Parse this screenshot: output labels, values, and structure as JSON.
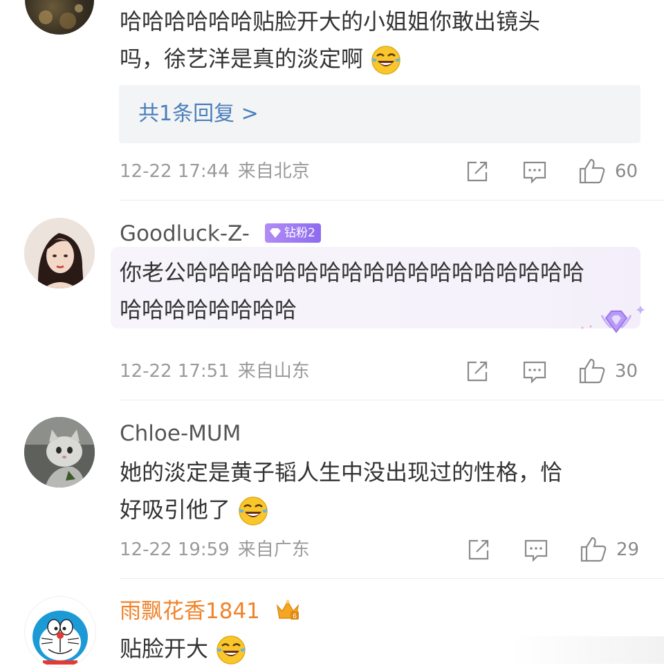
{
  "colors": {
    "link": "#4a7fb8",
    "meta": "#9a9a9a",
    "orange_name": "#f08329",
    "badge": "#9b7bf2"
  },
  "comments": [
    {
      "username": "",
      "text_line1": "哈哈哈哈哈哈贴脸开大的小姐姐你敢出镜头",
      "text_line2": "吗，徐艺洋是真的淡定啊",
      "emoji": "laugh-cry-emoji",
      "replies_link": "共1条回复 >",
      "time": "12-22 17:44",
      "location": "来自北京",
      "likes": "60"
    },
    {
      "username": "Goodluck-Z-",
      "badge": "钻粉2",
      "text_line1": "你老公哈哈哈哈哈哈哈哈哈哈哈哈哈哈哈哈哈哈",
      "text_line2": "哈哈哈哈哈哈哈哈",
      "time": "12-22 17:51",
      "location": "来自山东",
      "likes": "30"
    },
    {
      "username": "Chloe-MUM",
      "text_line1": "她的淡定是黄子韬人生中没出现过的性格，恰",
      "text_line2": "好吸引他了",
      "emoji": "laugh-cry-emoji",
      "time": "12-22 19:59",
      "location": "来自广东",
      "likes": "29"
    },
    {
      "username": "雨飘花香1841",
      "crown_level": "6",
      "text_line1": "贴脸开大",
      "emoji": "laugh-cry-emoji"
    }
  ],
  "icons": [
    "share-icon",
    "comment-icon",
    "like-icon"
  ]
}
